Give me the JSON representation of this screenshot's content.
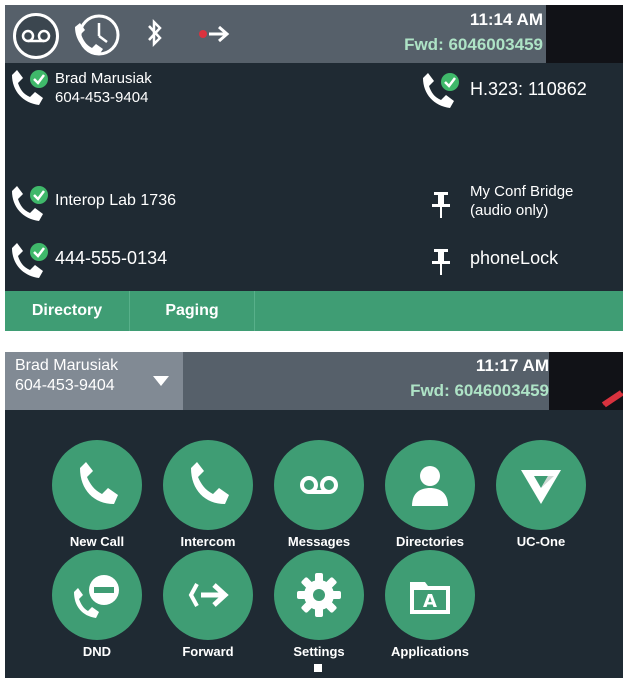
{
  "screen1": {
    "status": {
      "time": "11:14 AM",
      "forward": "Fwd: 6046003459"
    },
    "status_icons": [
      "voicemail-icon",
      "call-history-icon",
      "bluetooth-icon",
      "call-forward-icon"
    ],
    "lines": [
      {
        "name": "Brad Marusiak",
        "number": "604-453-9404"
      },
      {
        "label": "Interop Lab 1736"
      },
      {
        "label": "444-555-0134"
      }
    ],
    "right_keys": [
      {
        "label": "H.323: 110862"
      },
      {
        "label": "My Conf Bridge",
        "sub": "(audio only)"
      },
      {
        "label": "phoneLock"
      }
    ],
    "softkeys": [
      "Directory",
      "Paging"
    ]
  },
  "screen2": {
    "line": {
      "name": "Brad Marusiak",
      "number": "604-453-9404"
    },
    "status": {
      "time": "11:17 AM",
      "forward": "Fwd: 6046003459"
    },
    "apps": [
      {
        "label": "New Call",
        "icon": "phone-icon"
      },
      {
        "label": "Intercom",
        "icon": "phone-icon"
      },
      {
        "label": "Messages",
        "icon": "voicemail-icon"
      },
      {
        "label": "Directories",
        "icon": "person-icon"
      },
      {
        "label": "UC-One",
        "icon": "uc-one-logo-icon"
      },
      {
        "label": "DND",
        "icon": "do-not-disturb-icon"
      },
      {
        "label": "Forward",
        "icon": "forward-icon"
      },
      {
        "label": "Settings",
        "icon": "gear-icon"
      },
      {
        "label": "Applications",
        "icon": "applications-icon"
      }
    ]
  },
  "colors": {
    "accent": "#3f9d74",
    "background": "#1f2a33",
    "status_bar": "#56606a",
    "forward_text": "#aee3c6"
  }
}
